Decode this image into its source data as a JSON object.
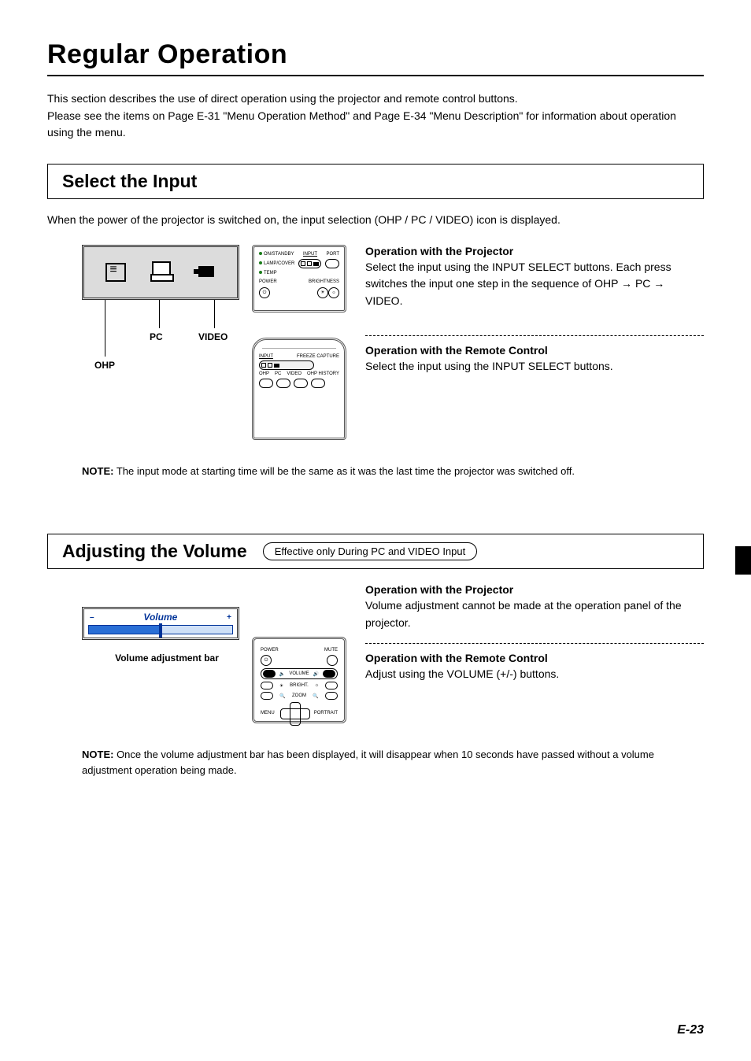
{
  "page": {
    "title": "Regular Operation",
    "intro_l1": "This section describes the use of direct operation using the projector and remote control buttons.",
    "intro_l2": "Please see the items on Page E-31 \"Menu Operation Method\" and Page E-34 \"Menu Description\" for information about operation using the menu.",
    "page_number": "E-23"
  },
  "section1": {
    "heading": "Select the Input",
    "lead": "When the power of the projector is switched on, the input selection (OHP / PC / VIDEO) icon is displayed.",
    "callout_ohp": "OHP",
    "callout_pc": "PC",
    "callout_video": "VIDEO",
    "panel": {
      "led1": "ON/STANDBY",
      "led2": "LAMP/COVER",
      "led3": "TEMP",
      "input": "INPUT",
      "port": "PORT",
      "power": "POWER",
      "brightness": "BRIGHTNESS"
    },
    "remote": {
      "input": "INPUT",
      "freeze": "FREEZE CAPTURE",
      "ohp": "OHP",
      "pc": "PC",
      "video": "VIDEO",
      "ohp_history": "OHP HISTORY"
    },
    "proj_head": "Operation with the Projector",
    "proj_body": "Select the input using the INPUT SELECT buttons. Each press switches the input one step in the sequence of OHP → PC → VIDEO.",
    "rc_head": "Operation with the Remote Control",
    "rc_body": "Select the input using the INPUT SELECT buttons.",
    "note_label": "NOTE:",
    "note_body": " The input mode at starting time will be the same as it was the last time the projector was switched off."
  },
  "section2": {
    "heading": "Adjusting the Volume",
    "pill": "Effective only During PC and VIDEO Input",
    "bar_title": "Volume",
    "bar_minus": "–",
    "bar_plus": "+",
    "bar_caption": "Volume adjustment bar",
    "remote": {
      "power": "POWER",
      "mute": "MUTE",
      "volume": "VOLUME",
      "bright": "BRIGHT.",
      "zoom": "ZOOM",
      "menu": "MENU",
      "portrait": "PORTRAIT"
    },
    "proj_head": "Operation with the Projector",
    "proj_body": "Volume adjustment cannot be made at the operation panel of the projector.",
    "rc_head": "Operation with the Remote Control",
    "rc_body": "Adjust using the VOLUME (+/-) buttons.",
    "note_label": "NOTE:",
    "note_body": " Once the volume adjustment bar has been displayed, it will disappear when 10 seconds have passed without a volume adjustment operation being made."
  }
}
